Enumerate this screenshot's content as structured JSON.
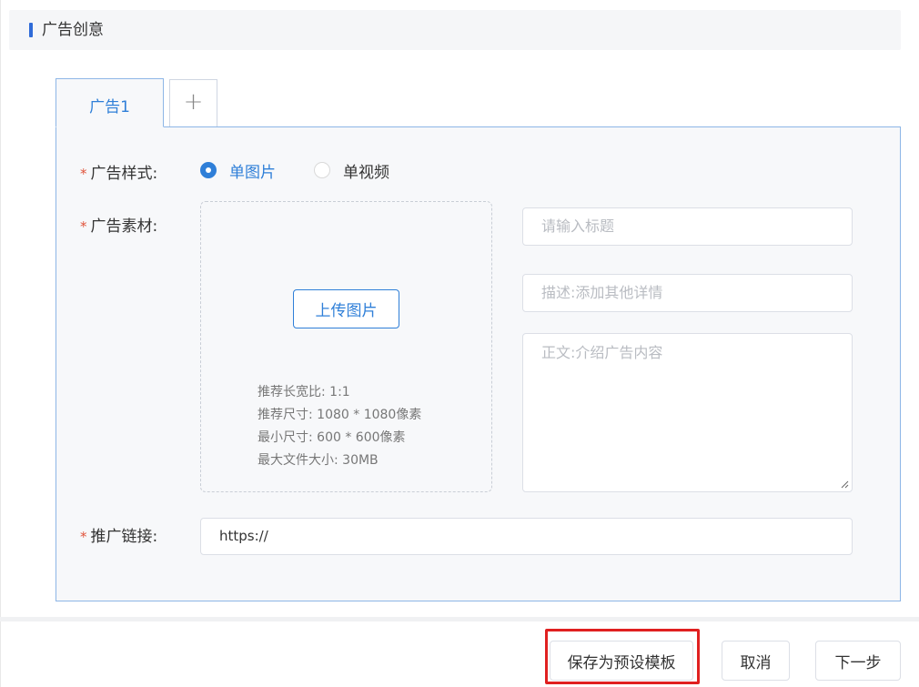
{
  "section": {
    "title": "广告创意"
  },
  "tabs": [
    {
      "label": "广告1",
      "active": true
    },
    {
      "label": "+",
      "active": false
    }
  ],
  "form": {
    "style_label": "广告样式:",
    "style_options": [
      {
        "label": "单图片",
        "checked": true
      },
      {
        "label": "单视频",
        "checked": false
      }
    ],
    "material_label": "广告素材:",
    "upload_button": "上传图片",
    "upload_tips": [
      "推荐长宽比: 1:1",
      "推荐尺寸: 1080 * 1080像素",
      "最小尺寸: 600 * 600像素",
      "最大文件大小: 30MB"
    ],
    "title_placeholder": "请输入标题",
    "desc_placeholder": "描述:添加其他详情",
    "body_placeholder": "正文:介绍广告内容",
    "link_label": "推广链接:",
    "link_value": "https://",
    "required_mark": "*"
  },
  "footer": {
    "save_template": "保存为预设模板",
    "cancel": "取消",
    "next": "下一步"
  },
  "colors": {
    "accent": "#2f7fd8",
    "required": "#e0543b",
    "highlight": "#e02020"
  }
}
